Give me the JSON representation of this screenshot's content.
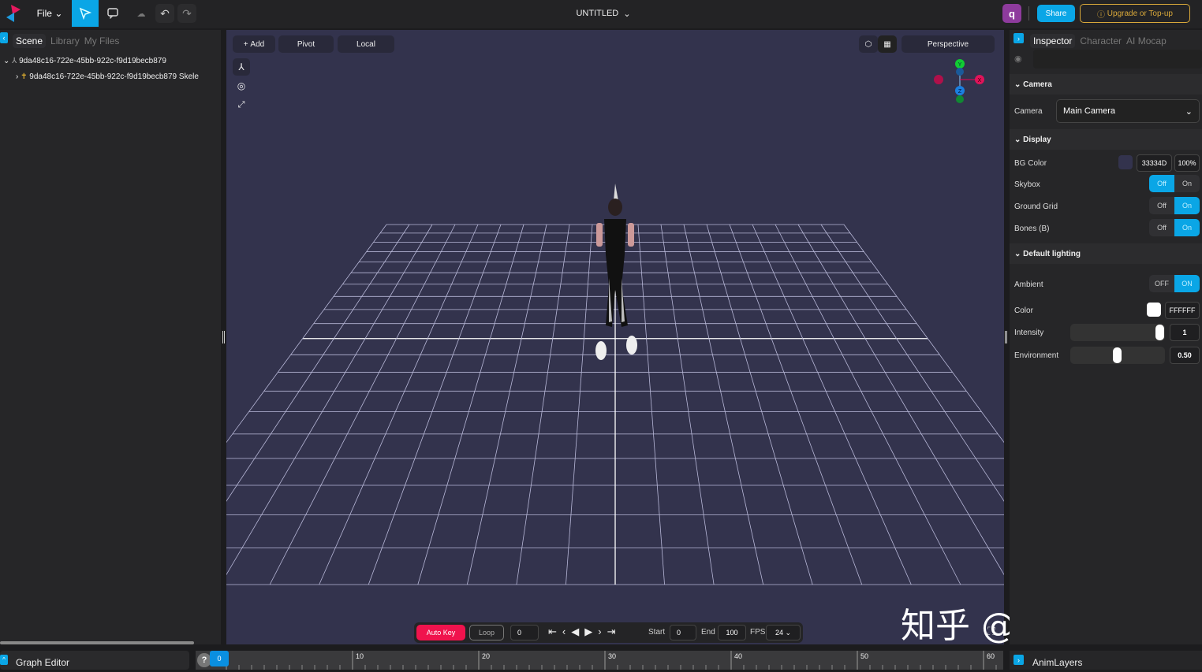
{
  "header": {
    "file_label": "File",
    "title": "UNTITLED",
    "avatar_letter": "q",
    "share_label": "Share",
    "upgrade_label": "Upgrade or Top-up"
  },
  "left_panel": {
    "tabs": [
      {
        "label": "Scene",
        "active": true
      },
      {
        "label": "Library",
        "active": false
      },
      {
        "label": "My Files",
        "active": false
      }
    ],
    "tree": [
      {
        "label": "9da48c16-722e-45bb-922c-f9d19becb879",
        "expanded": true
      },
      {
        "label": "9da48c16-722e-45bb-922c-f9d19becb879 Skele",
        "expanded": false
      }
    ]
  },
  "viewport": {
    "add_label": "Add",
    "pivot_label": "Pivot",
    "local_label": "Local",
    "view_mode": "Perspective",
    "bg_color": "#33334D",
    "gizmo": {
      "y": "Y",
      "x": "X",
      "z": "Z"
    }
  },
  "inspector": {
    "tabs": [
      {
        "label": "Inspector",
        "active": true
      },
      {
        "label": "Character",
        "active": false
      },
      {
        "label": "AI Mocap",
        "active": false
      }
    ],
    "camera_section": "Camera",
    "camera_label": "Camera",
    "camera_value": "Main Camera",
    "display_section": "Display",
    "bg_color_label": "BG Color",
    "bg_color_hex": "33334D",
    "bg_opacity": "100%",
    "skybox_label": "Skybox",
    "skybox": "Off",
    "ground_grid_label": "Ground Grid",
    "ground_grid": "On",
    "bones_label": "Bones (B)",
    "bones": "On",
    "off": "Off",
    "on": "On",
    "OFF": "OFF",
    "ON": "ON",
    "lighting_section": "Default lighting",
    "ambient_label": "Ambient",
    "ambient": "ON",
    "color_label": "Color",
    "color_hex": "FFFFFF",
    "intensity_label": "Intensity",
    "intensity": "1",
    "environment_label": "Environment",
    "environment": "0.50",
    "environment_fraction": 0.5,
    "intensity_fraction": 1
  },
  "playback": {
    "auto_key": "Auto Key",
    "loop": "Loop",
    "frame": "0",
    "start_label": "Start",
    "start": "0",
    "end_label": "End",
    "end": "100",
    "fps_label": "FPS",
    "fps": "24"
  },
  "bottom": {
    "graph_editor": "Graph Editor",
    "help": "?",
    "playhead": "0",
    "anim_layers": "AnimLayers",
    "ticks": [
      "10",
      "20",
      "30",
      "40",
      "50",
      "60"
    ]
  },
  "watermark": "知乎 @DevPoint",
  "colors": {
    "accent": "#0aa6e6",
    "auto_key": "#f0134d",
    "upgrade": "#d9a83a"
  }
}
